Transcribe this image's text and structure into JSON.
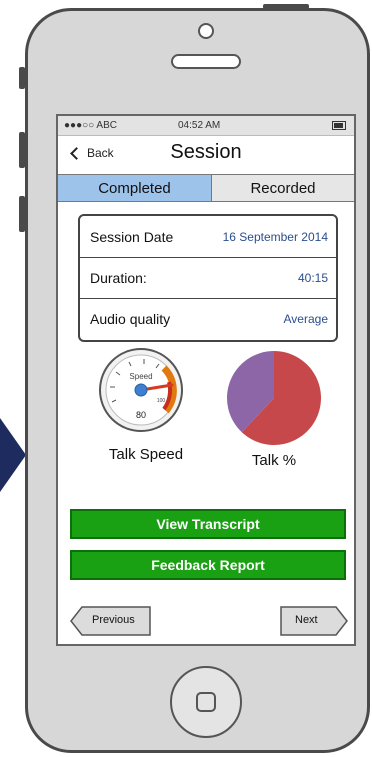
{
  "status_bar": {
    "carrier": "●●●○○ ABC",
    "time": "04:52 AM"
  },
  "nav": {
    "back_label": "Back",
    "title": "Session"
  },
  "tabs": [
    {
      "label": "Completed"
    },
    {
      "label": "Recorded"
    }
  ],
  "session_info": [
    {
      "label": "Session Date",
      "value": "16 September 2014"
    },
    {
      "label": "Duration:",
      "value": "40:15"
    },
    {
      "label": "Audio quality",
      "value": "Average"
    }
  ],
  "talk_speed": {
    "gauge_title": "Speed",
    "reading": "80",
    "scale_max": "100",
    "label": "Talk Speed"
  },
  "talk_percent": {
    "label": "Talk %",
    "share": 0.62,
    "colors": [
      "#c6484a",
      "#8d66a8"
    ]
  },
  "actions": {
    "view_transcript": "View Transcript",
    "feedback_report": "Feedback Report"
  },
  "pager": {
    "previous": "Previous",
    "next": "Next"
  },
  "colors": {
    "tab_active": "#9dc3ea",
    "button_green": "#1aa013",
    "side_arrow": "#1d2b5e"
  }
}
